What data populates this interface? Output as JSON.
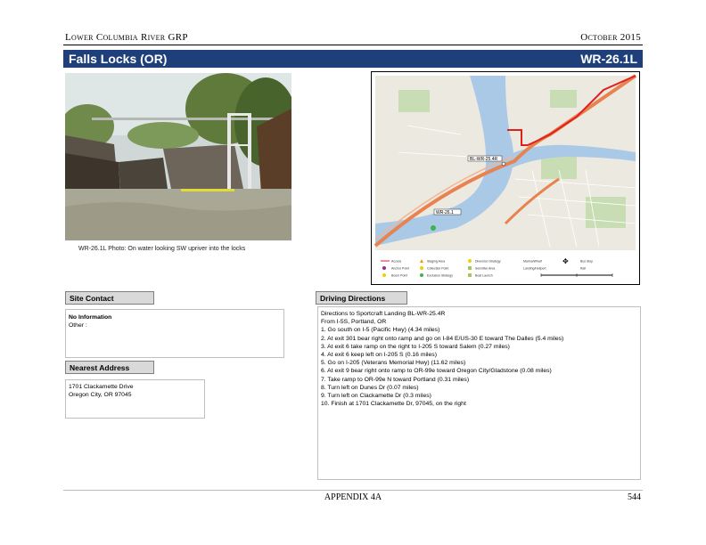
{
  "header": {
    "left": "Lower Columbia River GRP",
    "right": "October 2015"
  },
  "title": {
    "name": "Falls Locks (OR)",
    "code": "WR-26.1L"
  },
  "photo": {
    "caption": "WR-26.1L Photo: On water looking SW upriver into the locks"
  },
  "map": {
    "labels": {
      "site_bl": "BL-WR-25.4R",
      "site_wr": "WR-26.1"
    },
    "legend": [
      "Access",
      "Anchor Point",
      "Boom Point",
      "Staging Area",
      "Collection Point",
      "Exclusion Strategy",
      "Diversion Strategy",
      "Sensitive Area",
      "Boat Launch",
      "Marina/Wharf",
      "Landing/Heliport",
      "Bus Stop",
      "Rail",
      "Boundaries"
    ],
    "colors": {
      "water": "#a9c9e6",
      "land": "#ece9e1",
      "green": "#c9ddb4",
      "highway": "#e8824f",
      "route": "#e0201b"
    }
  },
  "site_contact": {
    "label": "Site Contact",
    "line1": "No Information",
    "line2": "Other :"
  },
  "nearest_address": {
    "label": "Nearest Address",
    "line1": "1701 Clackamette Drive",
    "line2": "Oregon City, OR 97045"
  },
  "driving": {
    "label": "Driving Directions",
    "lines": [
      "Directions to Sportcraft Landing BL-WR-25.4R",
      "From I-5S, Portland, OR",
      "1. Go south on I-5 (Pacific Hwy) (4.34 miles)",
      "2. At exit 301 bear right onto ramp and go on I-84 E/US-30 E toward The Dalles (5.4 miles)",
      "3. At exit 6 take ramp on the right to I-205 S toward Salem (0.27 miles)",
      "4. At exit 6 keep left on I-205 S (0.16 miles)",
      "5. Go on I-205 (Veterans Memorial Hwy) (11.62 miles)",
      "6. At exit 9 bear right onto ramp to OR-99e toward Oregon City/Gladstone (0.08 miles)",
      "7. Take ramp to OR-99e N toward Portland (0.31 miles)",
      "8. Turn left on Dunes Dr (0.07 miles)",
      "9. Turn left on Clackamette Dr (0.3 miles)",
      "10. Finish at 1701 Clackamette Dr, 97045, on the right"
    ]
  },
  "footer": {
    "center": "APPENDIX 4A",
    "page": "544"
  }
}
